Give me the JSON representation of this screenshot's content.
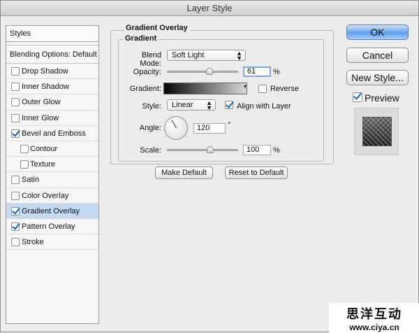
{
  "window": {
    "title": "Layer Style"
  },
  "sidebar": {
    "header": "Styles",
    "blending": "Blending Options: Default",
    "items": [
      {
        "label": "Drop Shadow",
        "checked": false,
        "sub": false,
        "selected": false
      },
      {
        "label": "Inner Shadow",
        "checked": false,
        "sub": false,
        "selected": false
      },
      {
        "label": "Outer Glow",
        "checked": false,
        "sub": false,
        "selected": false
      },
      {
        "label": "Inner Glow",
        "checked": false,
        "sub": false,
        "selected": false
      },
      {
        "label": "Bevel and Emboss",
        "checked": true,
        "sub": false,
        "selected": false
      },
      {
        "label": "Contour",
        "checked": false,
        "sub": true,
        "selected": false
      },
      {
        "label": "Texture",
        "checked": false,
        "sub": true,
        "selected": false
      },
      {
        "label": "Satin",
        "checked": false,
        "sub": false,
        "selected": false
      },
      {
        "label": "Color Overlay",
        "checked": false,
        "sub": false,
        "selected": false
      },
      {
        "label": "Gradient Overlay",
        "checked": true,
        "sub": false,
        "selected": true
      },
      {
        "label": "Pattern Overlay",
        "checked": true,
        "sub": false,
        "selected": false
      },
      {
        "label": "Stroke",
        "checked": false,
        "sub": false,
        "selected": false
      }
    ]
  },
  "panel": {
    "title": "Gradient Overlay",
    "subtitle": "Gradient",
    "blend_mode_label": "Blend Mode:",
    "blend_mode_value": "Soft Light",
    "opacity_label": "Opacity:",
    "opacity_value": "61",
    "opacity_unit": "%",
    "gradient_label": "Gradient:",
    "reverse_label": "Reverse",
    "reverse_checked": false,
    "style_label": "Style:",
    "style_value": "Linear",
    "align_label": "Align with Layer",
    "align_checked": true,
    "angle_label": "Angle:",
    "angle_value": "120",
    "angle_unit": "°",
    "scale_label": "Scale:",
    "scale_value": "100",
    "scale_unit": "%",
    "make_default": "Make Default",
    "reset_default": "Reset to Default"
  },
  "actions": {
    "ok": "OK",
    "cancel": "Cancel",
    "new_style": "New Style...",
    "preview_label": "Preview",
    "preview_checked": true
  },
  "watermark": {
    "chinese": "思洋互动",
    "url": "www.ciya.cn"
  }
}
